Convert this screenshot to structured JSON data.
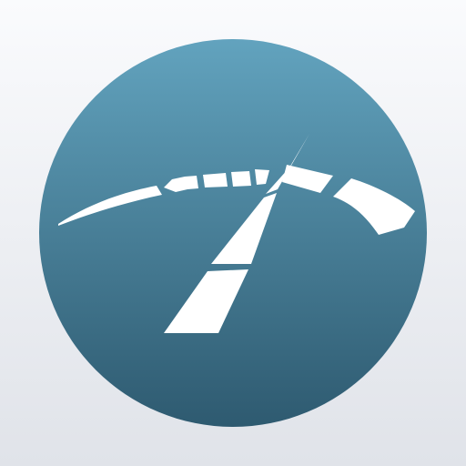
{
  "icon": {
    "name": "speedometer-gauge-icon",
    "colors": {
      "circle_top": "#62a3be",
      "circle_bottom": "#2e5a70",
      "background_top": "#fafbfd",
      "background_bottom": "#e0e3e9",
      "glyph": "#ffffff"
    }
  }
}
